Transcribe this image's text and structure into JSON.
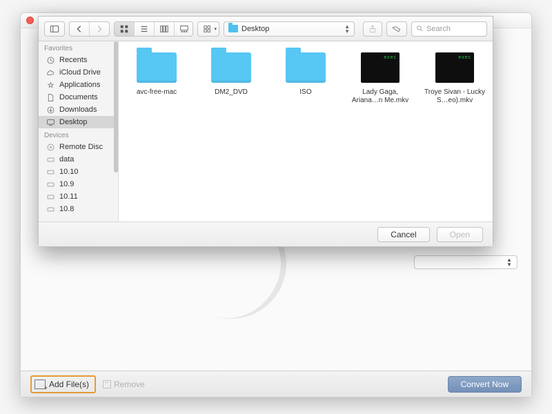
{
  "window": {
    "close": "close",
    "minimize": "minimize",
    "zoom": "zoom"
  },
  "finder": {
    "toolbar": {
      "location_label": "Desktop",
      "search_placeholder": "Search"
    },
    "sidebar": {
      "section_favorites": "Favorites",
      "section_devices": "Devices",
      "favorites": [
        {
          "label": "Recents"
        },
        {
          "label": "iCloud Drive"
        },
        {
          "label": "Applications"
        },
        {
          "label": "Documents"
        },
        {
          "label": "Downloads"
        },
        {
          "label": "Desktop"
        }
      ],
      "devices": [
        {
          "label": "Remote Disc"
        },
        {
          "label": "data"
        },
        {
          "label": "10.10"
        },
        {
          "label": "10.9"
        },
        {
          "label": "10.11"
        },
        {
          "label": "10.8"
        }
      ]
    },
    "files": [
      {
        "type": "folder",
        "name": "avc-free-mac"
      },
      {
        "type": "folder",
        "name": "DM2_DVD"
      },
      {
        "type": "folder",
        "name": "ISO"
      },
      {
        "type": "video",
        "name": "Lady Gaga, Ariana…n Me.mkv",
        "thumb_text": "exec"
      },
      {
        "type": "video",
        "name": "Troye Sivan - Lucky S…eo).mkv",
        "thumb_text": "exec"
      }
    ],
    "footer": {
      "cancel": "Cancel",
      "open": "Open"
    }
  },
  "app": {
    "add_files": "Add File(s)",
    "remove": "Remove",
    "convert": "Convert Now"
  }
}
